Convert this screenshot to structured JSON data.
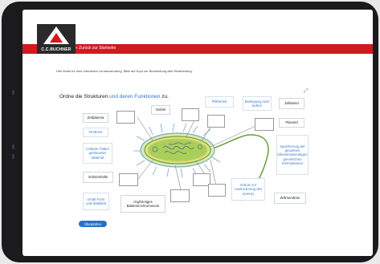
{
  "header": {
    "logo_text": "C.C.BUCHNER",
    "back_link": "« Zurück zur Startseite"
  },
  "task": {
    "instruction": "Hier findet ihr eine interaktive Lernanwendung. Bitte auf Kopf zur Bearbeitung aller Bearbeitung.",
    "title_prefix": "Ordne die Strukturen ",
    "title_highlight": "und deren Funktionen",
    "title_suffix": " zu."
  },
  "labels": {
    "geissel": "Geißel",
    "zellplasma": "Zellplasma",
    "fimbrien": "Fimbrien",
    "lmd": "Lösbare Fäden gesteuerter Material",
    "schleimhuelle": "Schleimhülle",
    "form": "erhält Form und Stabilität",
    "ringfoermig": "ringförmiges Bakterienchromosom",
    "pilifreiheit": "Pilifreiheit",
    "bewegung": "Bewegung nach außen",
    "zellwand": "Zellwand",
    "plasmid": "Plasmid",
    "speicherung": "Speicherung der gesamten lebensnotwendigen genetischen Informationen",
    "schutz": "Schutz vor Austrocknung des Inneres",
    "zellmembran": "Zellmembran"
  },
  "buttons": {
    "check": "Überprüfen"
  },
  "colors": {
    "brand_red": "#d01a1f",
    "accent_blue": "#2c6fc7"
  }
}
